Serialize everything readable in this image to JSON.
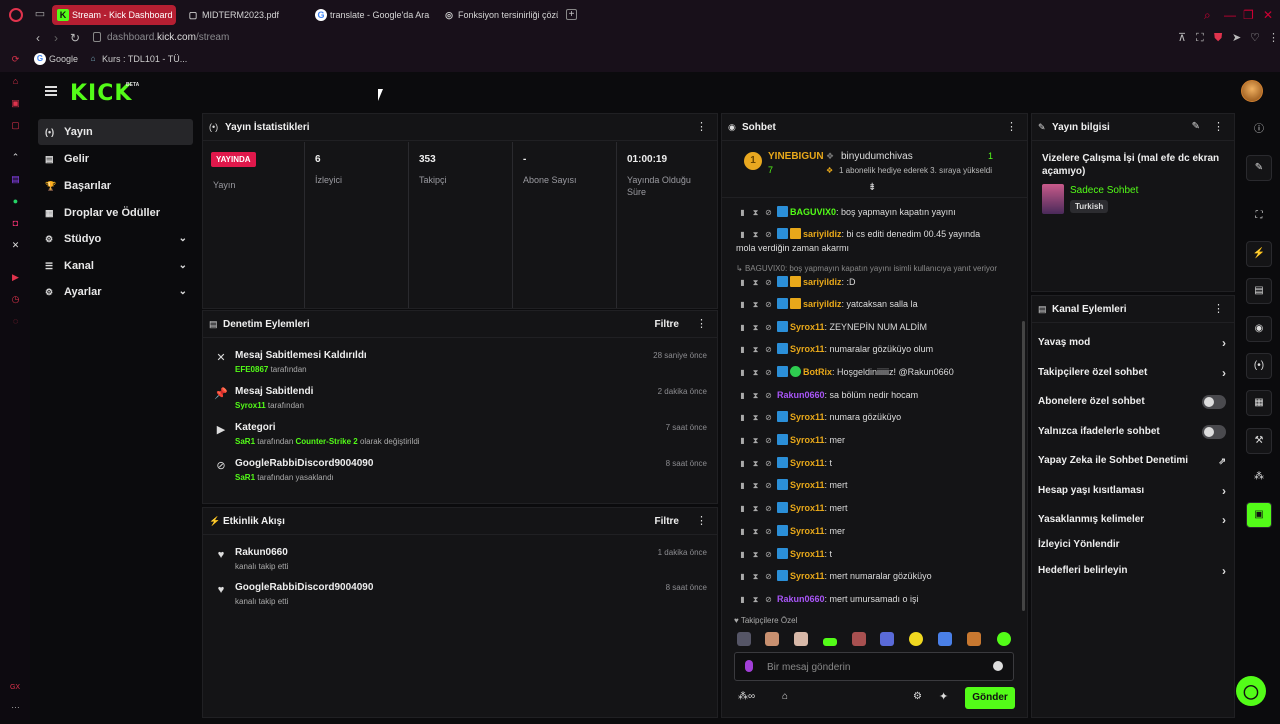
{
  "browser": {
    "tabs": [
      {
        "label": "Stream - Kick Dashboard",
        "favicon": "K"
      },
      {
        "label": "MIDTERM2023.pdf",
        "favicon": "▢"
      },
      {
        "label": "translate - Google'da Ara",
        "favicon": "G"
      },
      {
        "label": "Fonksiyon tersinirliği çözü",
        "favicon": "◎"
      }
    ],
    "new_tab": "+",
    "url_prefix": "dashboard.",
    "url_domain": "kick.com",
    "url_path": "/stream",
    "bookmarks": [
      {
        "label": "Google",
        "icon": "G"
      },
      {
        "label": "Kurs : TDL101 - TÜ...",
        "icon": "⌂"
      }
    ],
    "opera_side_label": "GX"
  },
  "app": {
    "logo": "KICK",
    "logo_badge": "BETA",
    "accent": "#53fc18"
  },
  "nav": {
    "items": [
      {
        "label": "Yayın",
        "icon": "(•)",
        "active": true
      },
      {
        "label": "Gelir",
        "icon": "▤"
      },
      {
        "label": "Başarılar",
        "icon": "🏆"
      },
      {
        "label": "Droplar ve Ödüller",
        "icon": "▦"
      },
      {
        "label": "Stüdyo",
        "icon": "⚙",
        "chevron": "⌄"
      },
      {
        "label": "Kanal",
        "icon": "☰",
        "chevron": "⌄"
      },
      {
        "label": "Ayarlar",
        "icon": "⚙",
        "chevron": "⌄"
      }
    ]
  },
  "stats": {
    "title": "Yayın İstatistikleri",
    "live_badge": "YAYINDA",
    "live_label": "Yayın",
    "cols": [
      {
        "value": "6",
        "label": "İzleyici"
      },
      {
        "value": "353",
        "label": "Takipçi"
      },
      {
        "value": "-",
        "label": "Abone Sayısı"
      },
      {
        "value": "01:00:19",
        "label": "Yayında Olduğu Süre"
      }
    ]
  },
  "moderation": {
    "title": "Denetim Eylemleri",
    "filter": "Filtre",
    "rows": [
      {
        "title": "Mesaj Sabitlemesi Kaldırıldı",
        "user": "EFE0867",
        "suffix": " tarafından",
        "time": "28 saniye önce",
        "icon": "✕"
      },
      {
        "title": "Mesaj Sabitlendi",
        "user": "Syrox11",
        "suffix": " tarafından",
        "time": "2 dakika önce",
        "icon": "📌"
      },
      {
        "title": "Kategori",
        "user": "SaR1",
        "suffix": " tarafından ",
        "extra": "Counter-Strike 2",
        "extra_suffix": " olarak değiştirildi",
        "time": "7 saat önce",
        "icon": "▶"
      },
      {
        "title": "GoogleRabbiDiscord9004090",
        "user": "SaR1",
        "suffix": " tarafından yasaklandı",
        "time": "8 saat önce",
        "icon": "⊘"
      }
    ]
  },
  "activity": {
    "title": "Etkinlik Akışı",
    "filter": "Filtre",
    "rows": [
      {
        "title": "Rakun0660",
        "sub": "kanalı takip etti",
        "time": "1 dakika önce"
      },
      {
        "title": "GoogleRabbiDiscord9004090",
        "sub": "kanalı takip etti",
        "time": "8 saat önce"
      }
    ]
  },
  "chat": {
    "title": "Sohbet",
    "pinned": {
      "rank": "1",
      "gifter": "YINEBIGUN",
      "gifter_count": "7",
      "recipient": "binyudumchivas",
      "recipient_count": "1",
      "message": "1 abonelik hediye ederek 3. sıraya yükseldi"
    },
    "reply_note": "BAGUVIX0: boş yapmayın kapatın yayını isimli kullanıcıya yanıt veriyor",
    "messages": [
      {
        "user": "BAGUVIX0",
        "color": "#53fc18",
        "badge": "bl",
        "text": ": boş yapmayın kapatın yayını"
      },
      {
        "user": "sariyildiz",
        "color": "#e8a81a",
        "badge": "cr",
        "text": ": bi cs editi denedim 00.45 yayında",
        "text2": "mola verdiğin zaman akarmı"
      },
      {
        "user": "sariyildiz",
        "color": "#e8a81a",
        "badge": "cr",
        "text": ": :D"
      },
      {
        "user": "sariyildiz",
        "color": "#e8a81a",
        "badge": "cr",
        "text": ": yatcaksan salla la"
      },
      {
        "user": "Syrox11",
        "color": "#e8a81a",
        "badge": "bl",
        "text": ": ZEYNEPİN NUM ALDİM"
      },
      {
        "user": "Syrox11",
        "color": "#e8a81a",
        "badge": "bl",
        "text": ": numaralar gözüküyo olum"
      },
      {
        "user": "BotRix",
        "color": "#e8a81a",
        "badge": "gr",
        "text": ": Hoşgeldiniiiiiiz! @Rakun0660"
      },
      {
        "user": "Rakun0660",
        "color": "#a855f7",
        "badge": "",
        "text": ": sa bölüm nedir hocam"
      },
      {
        "user": "Syrox11",
        "color": "#e8a81a",
        "badge": "bl",
        "text": ": numara gözüküyo"
      },
      {
        "user": "Syrox11",
        "color": "#e8a81a",
        "badge": "bl",
        "text": ": mer"
      },
      {
        "user": "Syrox11",
        "color": "#e8a81a",
        "badge": "bl",
        "text": ": t"
      },
      {
        "user": "Syrox11",
        "color": "#e8a81a",
        "badge": "bl",
        "text": ": mert"
      },
      {
        "user": "Syrox11",
        "color": "#e8a81a",
        "badge": "bl",
        "text": ": mert"
      },
      {
        "user": "Syrox11",
        "color": "#e8a81a",
        "badge": "bl",
        "text": ": mer"
      },
      {
        "user": "Syrox11",
        "color": "#e8a81a",
        "badge": "bl",
        "text": ": t"
      },
      {
        "user": "Syrox11",
        "color": "#e8a81a",
        "badge": "bl",
        "text": ": mert numaralar gözüküyo"
      },
      {
        "user": "Rakun0660",
        "color": "#a855f7",
        "badge": "",
        "text": ": mert umursamadı o işi"
      }
    ],
    "followers_only_label": "Takipçilere Özel",
    "input_placeholder": "Bir mesaj gönderin",
    "send_label": "Gönder"
  },
  "stream_info": {
    "title": "Yayın bilgisi",
    "stream_title": "Vizelere Çalışma İşi (mal efe dc ekran açamıyo)",
    "category": "Sadece Sohbet",
    "language": "Turkish"
  },
  "channel_actions": {
    "title": "Kanal Eylemleri",
    "rows": [
      {
        "label": "Yavaş mod",
        "control": "chevron"
      },
      {
        "label": "Takipçilere özel sohbet",
        "control": "chevron"
      },
      {
        "label": "Abonelere özel sohbet",
        "control": "toggle",
        "on": false
      },
      {
        "label": "Yalnızca ifadelerle sohbet",
        "control": "toggle",
        "on": false
      },
      {
        "label": "Yapay Zeka ile Sohbet Denetimi",
        "control": "external"
      },
      {
        "label": "Hesap yaşı kısıtlaması",
        "control": "chevron"
      },
      {
        "label": "Yasaklanmış kelimeler",
        "control": "chevron"
      },
      {
        "label": "İzleyici Yönlendir",
        "control": "none"
      },
      {
        "label": "Hedefleri belirleyin",
        "control": "chevron"
      }
    ]
  }
}
